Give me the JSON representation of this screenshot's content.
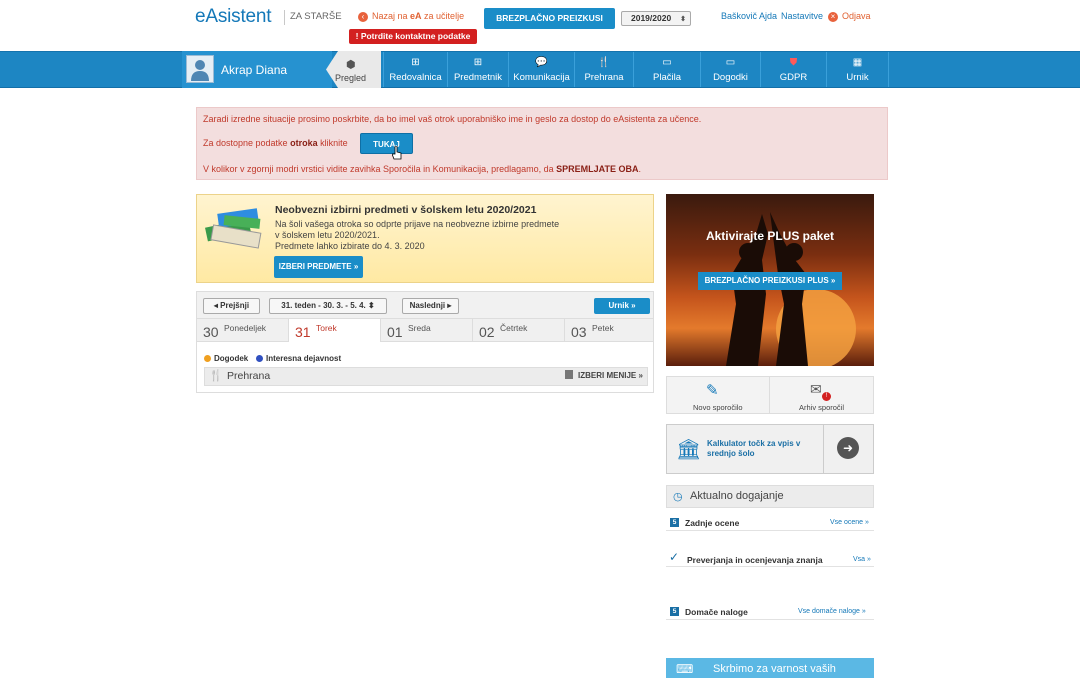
{
  "header": {
    "logo": "eAsistent",
    "logo_sub": "ZA STARŠE",
    "back_link_prefix": "Nazaj na ",
    "back_link_bold": "eA",
    "back_link_suffix": " za učitelje",
    "confirm_button": "Potrdite kontaktne podatke",
    "trial_button": "BREZPLAČNO PREIZKUSI PLUS »",
    "year": "2019/2020",
    "user_name": "Baškovič Ajda",
    "settings": "Nastavitve",
    "logout": "Odjava"
  },
  "nav": {
    "student": "Akrap Diana",
    "overview": "Pregled",
    "tabs": [
      {
        "label": "Redovalnica",
        "icon": "plus-square-icon"
      },
      {
        "label": "Predmetnik",
        "icon": "plus-square-icon"
      },
      {
        "label": "Komunikacija",
        "icon": "speech-bubble-icon"
      },
      {
        "label": "Prehrana",
        "icon": "food-icon"
      },
      {
        "label": "Plačila",
        "icon": "card-icon"
      },
      {
        "label": "Dogodki",
        "icon": "card-icon"
      },
      {
        "label": "GDPR",
        "icon": "shield-icon"
      },
      {
        "label": "Urnik",
        "icon": "calendar-icon"
      }
    ]
  },
  "alert": {
    "line1": "Zaradi izredne situacije prosimo poskrbite, da bo imel vaš otrok uporabniško ime in geslo za dostop do eAsistenta za učence.",
    "line2_prefix": "Za dostopne podatke ",
    "line2_bold": "otroka",
    "line2_suffix": " kliknite",
    "here_button": "TUKAJ",
    "line3_prefix": "V kolikor v zgornji modri vrstici vidite zavihka Sporočila in Komunikacija, predlagamo, da ",
    "line3_bold": "SPREMLJATE OBA",
    "line3_suffix": "."
  },
  "elective": {
    "title": "Neobvezni izbirni predmeti v šolskem letu 2020/2021",
    "text_line1": "Na šoli vašega otroka so odprte prijave na neobvezne izbirne predmete",
    "text_line2": "v šolskem letu 2020/2021.",
    "text_line3": "Predmete lahko izbirate do 4. 3. 2020",
    "button": "IZBERI PREDMETE »"
  },
  "week": {
    "prev": "Prejšnji",
    "current": "31. teden - 30. 3. - 5. 4.",
    "next": "Naslednji",
    "timetable": "Urnik »",
    "days": [
      {
        "num": "30",
        "name": "Ponedeljek"
      },
      {
        "num": "31",
        "name": "Torek"
      },
      {
        "num": "01",
        "name": "Sreda"
      },
      {
        "num": "02",
        "name": "Četrtek"
      },
      {
        "num": "03",
        "name": "Petek"
      }
    ],
    "legend_event": "Dogodek",
    "legend_interest": "Interesna dejavnost",
    "meal_label": "Prehrana",
    "menu_button": "IZBERI MENIJE »",
    "event_color": "#f0a020",
    "interest_color": "#3050c0"
  },
  "sidebar": {
    "ad_title": "Aktivirajte PLUS paket",
    "ad_button": "BREZPLAČNO PREIZKUSI PLUS »",
    "new_message": "Novo sporočilo",
    "archive": "Arhiv sporočil",
    "archive_badge": "!",
    "calc_text": "Kalkulator točk za vpis v srednjo šolo",
    "news_title": "Aktualno dogajanje",
    "grades_title": "Zadnje ocene",
    "grades_link": "Vse ocene »",
    "exams_title": "Preverjanja in ocenjevanja znanja",
    "exams_link": "Vsa »",
    "homework_title": "Domače naloge",
    "homework_link": "Vse domače naloge »",
    "bottom_banner": "Skrbimo za varnost vaših"
  },
  "colors": {
    "brand_blue": "#1d86c3",
    "alert_bg": "#f3dede",
    "alert_text": "#c0392b"
  }
}
